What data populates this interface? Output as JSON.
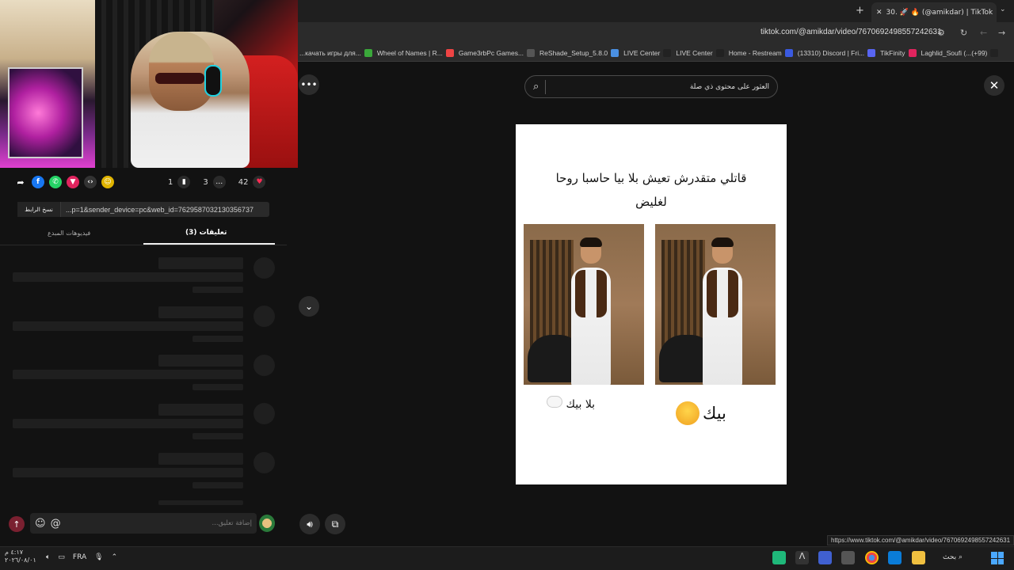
{
  "browser": {
    "tab_title": "30. 🚀 🔥 (@amikdar) | TikTok",
    "new_tab": "+",
    "tab_close": "✕",
    "url": "tiktok.com/@amikdar/video/7670692498557242631",
    "bookmarks": [
      {
        "label": "...качать игры для...",
        "color": "#3aa83a"
      },
      {
        "label": "Wheel of Names | R...",
        "color": "#e44"
      },
      {
        "label": "Game3rbPc Games...",
        "color": "#555"
      },
      {
        "label": "ReShade_Setup_5.8.0",
        "color": "#4a90e2"
      },
      {
        "label": "LIVE Center",
        "color": "#222"
      },
      {
        "label": "LIVE Center",
        "color": "#222"
      },
      {
        "label": "Home - Restream",
        "color": "#3a5ae0"
      },
      {
        "label": "(13310) Discord | Fri...",
        "color": "#5865f2"
      },
      {
        "label": "TikFinity",
        "color": "#e0245e"
      },
      {
        "label": "Laghlid_Soufi (...(+99)",
        "color": "#222"
      }
    ],
    "status_url": "https://www.tiktok.com/@amikdar/video/7670692498557242631"
  },
  "left_panel": {
    "like_count": "42",
    "comment_count": "3",
    "save_count": "1",
    "copy_link_label": "نسخ الرابط",
    "link_text": "...p=1&sender_device=pc&web_id=7629587032130356737",
    "tab_creator_videos": "فيديوهات المبدع",
    "tab_comments": "(3) تعليقات",
    "comment_placeholder": "إضافة تعليق..."
  },
  "video": {
    "search_placeholder": "العثور على محتوى ذي صلة",
    "caption": "قاتلي متقدرش تعيش بلا بيا حاسبا روحا لغليض",
    "label_left": "بلا بيك",
    "label_right": "بيك"
  },
  "taskbar": {
    "time": "٤:١٧ م",
    "date": "٢٠٢٦/٠٨/٠١",
    "language": "FRA",
    "search_label": "بحث"
  }
}
